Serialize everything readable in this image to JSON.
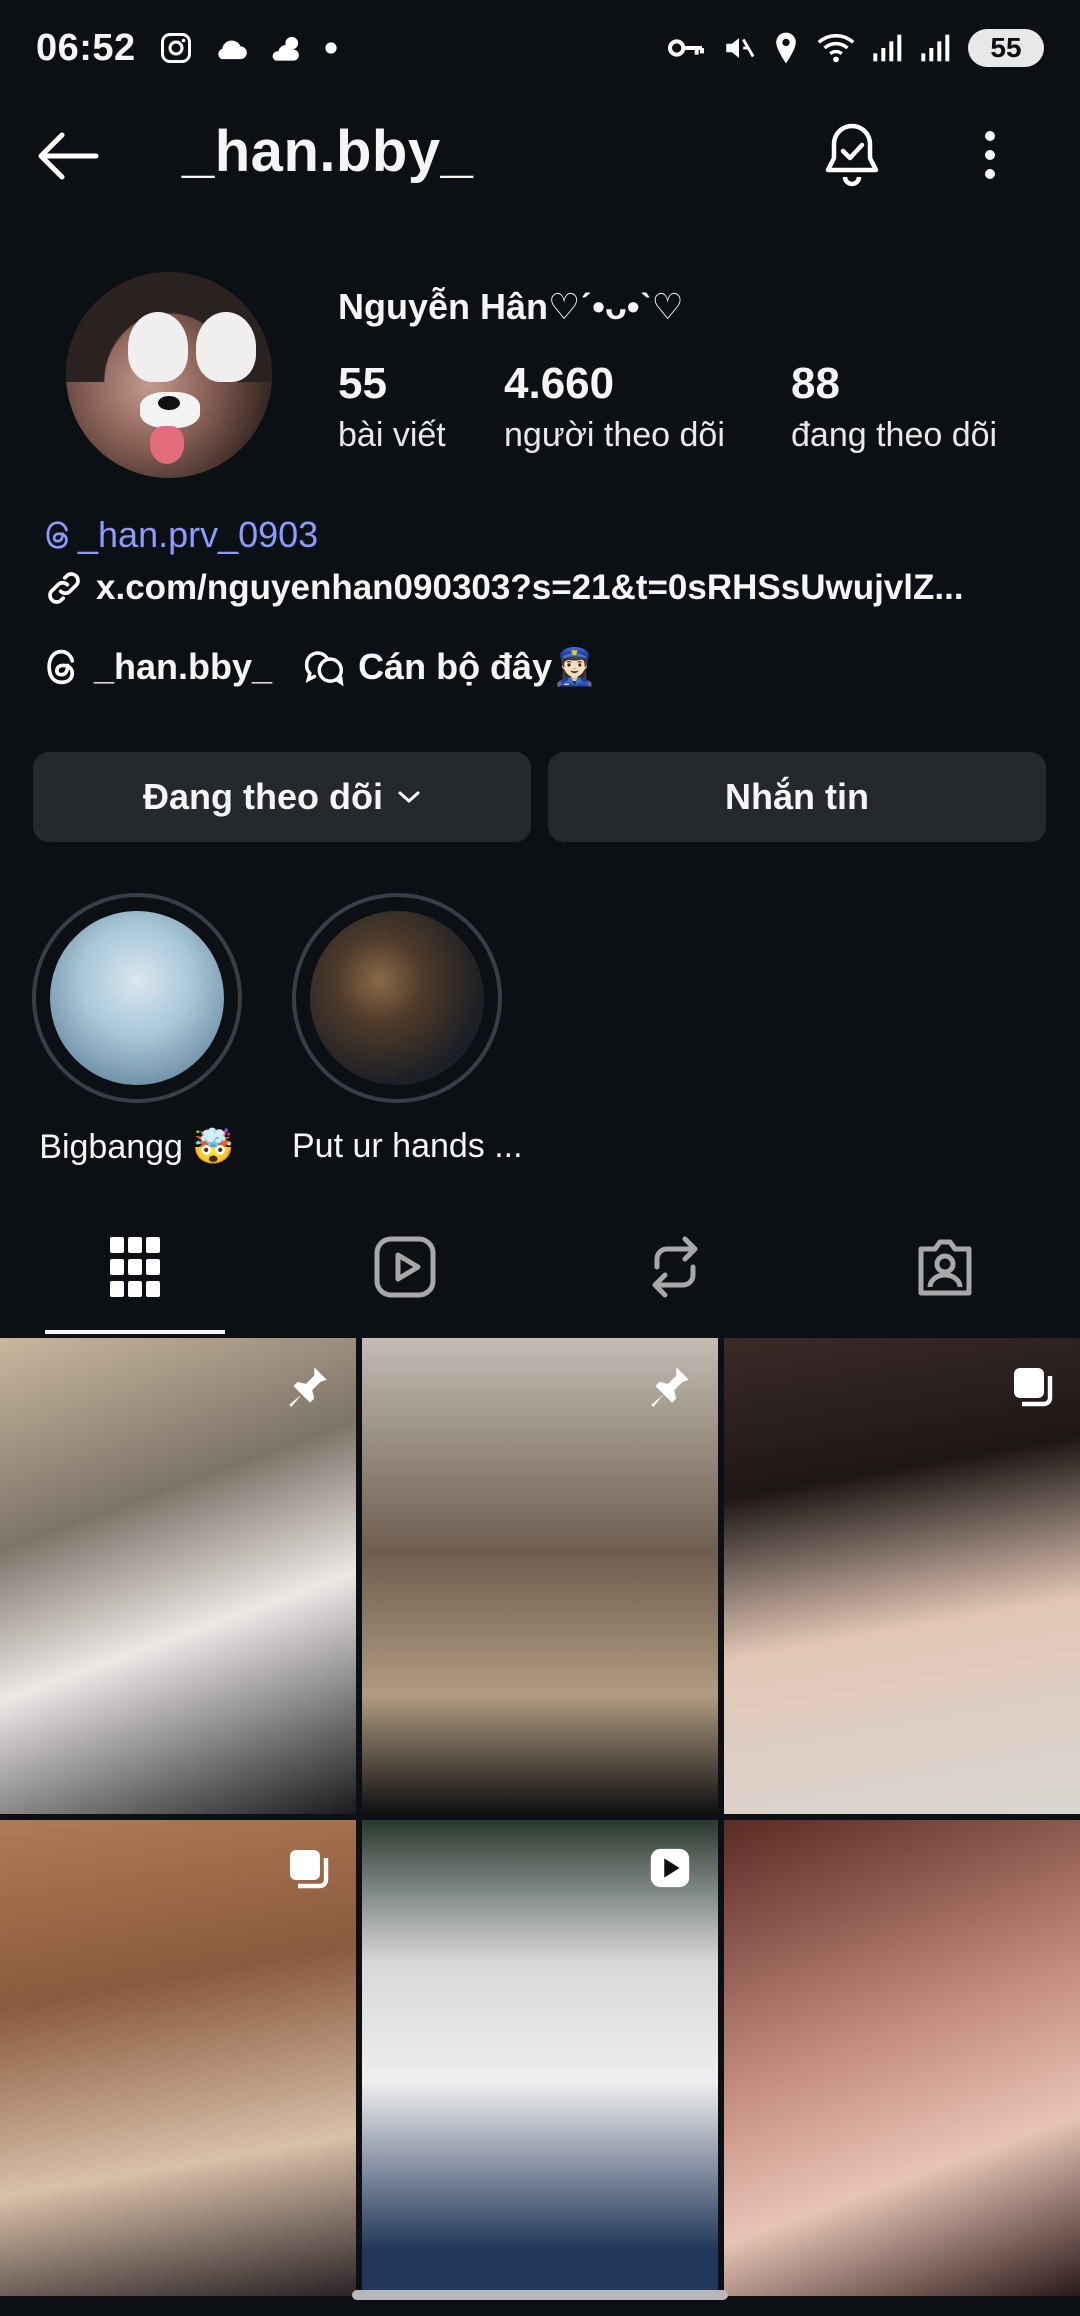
{
  "status_bar": {
    "time": "06:52",
    "battery": "55"
  },
  "header": {
    "username": "_han.bby_"
  },
  "profile": {
    "display_name": "Nguyễn Hân♡ˊ•ᴗ•ˋ♡",
    "stats": [
      {
        "value": "55",
        "label": "bài viết"
      },
      {
        "value": "4.660",
        "label": "người theo dõi"
      },
      {
        "value": "88",
        "label": "đang theo dõi"
      }
    ],
    "threads_handle": "_han.prv_0903",
    "link": "x.com/nguyenhan090303?s=21&t=0sRHSsUwujvlZ...",
    "threads_chip": "_han.bby_",
    "chat_chip": "Cán bộ đây👮🏻‍♀️"
  },
  "actions": {
    "following_label": "Đang theo dõi",
    "message_label": "Nhắn tin"
  },
  "highlights": [
    {
      "label": "Bigbangg 🤯"
    },
    {
      "label": "Put ur hands ..."
    }
  ],
  "tabs": [
    "grid-icon",
    "reels-icon",
    "reposts-icon",
    "tagged-icon"
  ],
  "colors": {
    "background": "#0c1014",
    "button": "#25292e",
    "link": "#8b9bff"
  }
}
